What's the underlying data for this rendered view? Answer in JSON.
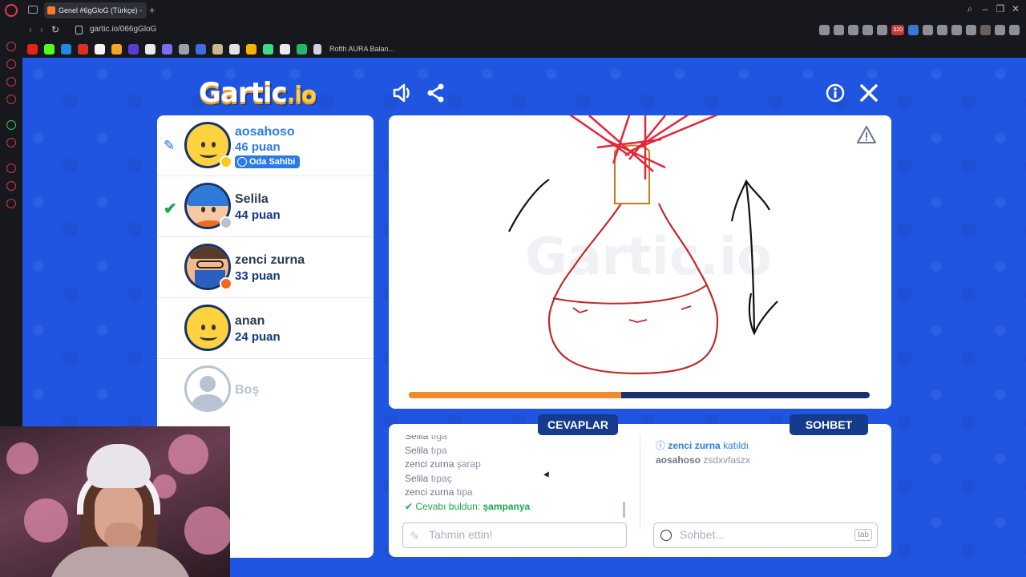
{
  "browser": {
    "tab_title": "Genel #6gGloG (Türkçe) -",
    "new_tab": "+",
    "url": "gartic.io/066gGloG",
    "bookmark_label": "Rofth AURA Balan...",
    "ext_badge": "320"
  },
  "game": {
    "logo_main": "Gartic",
    "logo_suffix": ".io",
    "players": [
      {
        "name": "aosahoso",
        "score": "46 puan",
        "badge": "Oda Sahibi",
        "status": "drawing"
      },
      {
        "name": "Selila",
        "score": "44 puan",
        "status": "guessed"
      },
      {
        "name": "zenci zurna",
        "score": "33 puan"
      },
      {
        "name": "anan",
        "score": "24 puan"
      },
      {
        "name": "Boş",
        "score": ""
      }
    ],
    "watermark": "Gartic.io",
    "timer_progress": 0.46,
    "tabs": {
      "answers": "CEVAPLAR",
      "chat": "SOHBET"
    },
    "answers": [
      {
        "who": "Selila",
        "text": "tıga"
      },
      {
        "who": "Selila",
        "text": "tıpa"
      },
      {
        "who": "zenci zurna",
        "text": "şarap"
      },
      {
        "who": "Selila",
        "text": "tıpaç"
      },
      {
        "who": "zenci zurna",
        "text": "tıpa"
      }
    ],
    "found_prefix": "Cevabı buldun:",
    "found_word": "şampanya",
    "chat": [
      {
        "who": "zenci zurna",
        "text": "katıldı",
        "type": "join"
      },
      {
        "who": "aosahoso",
        "text": "zsdxvfaszx",
        "type": "message"
      }
    ],
    "guess_placeholder": "Tahmin ettin!",
    "chat_placeholder": "Sohbet...",
    "tab_key": "tab"
  }
}
